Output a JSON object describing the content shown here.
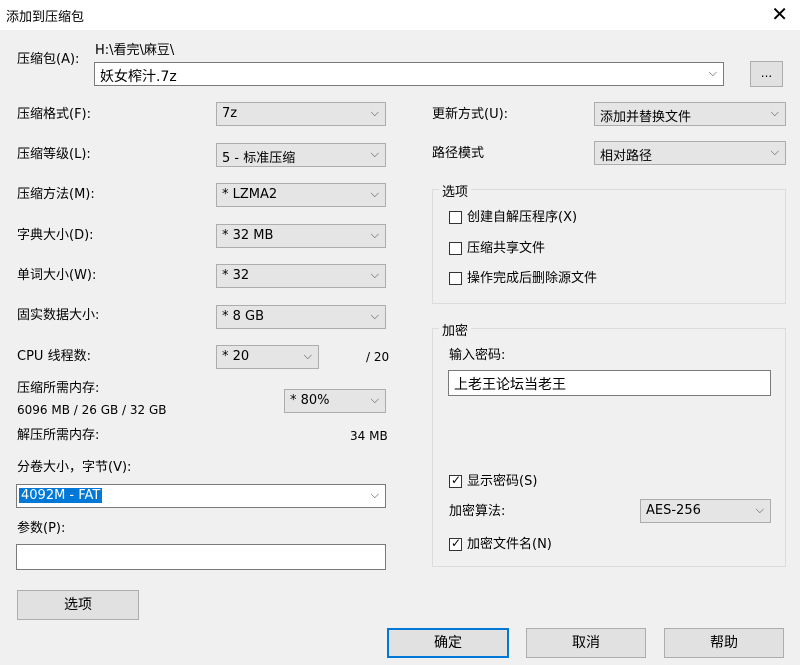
{
  "window": {
    "title": "添加到压缩包",
    "close_glyph": "✕"
  },
  "archive": {
    "label": "压缩包(A):",
    "path": "H:\\看完\\麻豆\\",
    "filename": "妖女榨汁.7z",
    "browse_label": "..."
  },
  "left": {
    "format": {
      "label": "压缩格式(F):",
      "value": "7z"
    },
    "level": {
      "label": "压缩等级(L):",
      "value": "5 - 标准压缩"
    },
    "method": {
      "label": "压缩方法(M):",
      "value": "* LZMA2"
    },
    "dict": {
      "label": "字典大小(D):",
      "value": "* 32 MB"
    },
    "word": {
      "label": "单词大小(W):",
      "value": "* 32"
    },
    "solid": {
      "label": "固实数据大小:",
      "value": "* 8 GB"
    },
    "threads": {
      "label": "CPU 线程数:",
      "value": "* 20",
      "max": "/ 20"
    },
    "mem_compress": {
      "label": "压缩所需内存:",
      "detail": "6096 MB / 26 GB / 32 GB",
      "value": "* 80%"
    },
    "mem_decompress": {
      "label": "解压所需内存:",
      "value": "34 MB"
    },
    "volume": {
      "label": "分卷大小，字节(V):",
      "value": "4092M - FAT"
    },
    "params": {
      "label": "参数(P):",
      "value": ""
    },
    "options_button": "选项"
  },
  "right": {
    "update": {
      "label": "更新方式(U):",
      "value": "添加并替换文件"
    },
    "pathmode": {
      "label": "路径模式",
      "value": "相对路径"
    },
    "options_group": {
      "title": "选项",
      "sfx": {
        "label": "创建自解压程序(X)",
        "checked": false
      },
      "shared": {
        "label": "压缩共享文件",
        "checked": false
      },
      "delete": {
        "label": "操作完成后删除源文件",
        "checked": false
      }
    },
    "encrypt_group": {
      "title": "加密",
      "password_label": "输入密码:",
      "password": "上老王论坛当老王",
      "show_password": {
        "label": "显示密码(S)",
        "checked": true
      },
      "method_label": "加密算法:",
      "method_value": "AES-256",
      "encrypt_names": {
        "label": "加密文件名(N)",
        "checked": true
      }
    }
  },
  "buttons": {
    "ok": "确定",
    "cancel": "取消",
    "help": "帮助"
  },
  "icons": {
    "dropdown": "chevron-down-icon",
    "check": "✓",
    "arrow_glyph": "⌵"
  }
}
